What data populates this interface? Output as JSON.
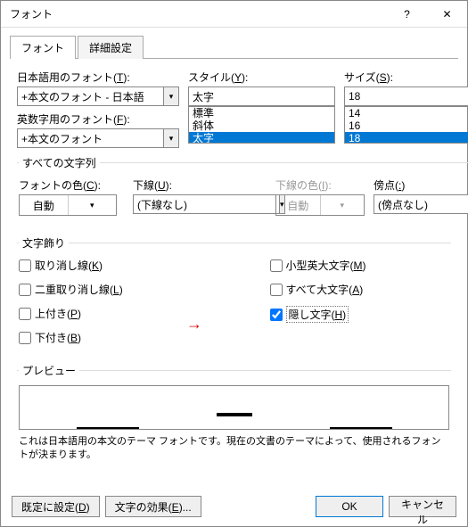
{
  "title": "フォント",
  "tabs": {
    "font": "フォント",
    "advanced": "詳細設定"
  },
  "font": {
    "jpLabelPre": "日本語用のフォント(",
    "jpKey": "T",
    "jpLabelPost": "):",
    "jpValue": "+本文のフォント - 日本語",
    "enLabelPre": "英数字用のフォント(",
    "enKey": "F",
    "enLabelPost": "):",
    "enValue": "+本文のフォント",
    "styleLabelPre": "スタイル(",
    "styleKey": "Y",
    "styleLabelPost": "):",
    "styleValue": "太字",
    "styleOpts": [
      "標準",
      "斜体",
      "太字"
    ],
    "sizeLabelPre": "サイズ(",
    "sizeKey": "S",
    "sizeLabelPost": "):",
    "sizeValue": "18",
    "sizeOpts": [
      "14",
      "16",
      "18"
    ]
  },
  "allchars": {
    "legend": "すべての文字列",
    "colorLabelPre": "フォントの色(",
    "colorKey": "C",
    "colorLabelPost": "):",
    "colorValue": "自動",
    "ulLabelPre": "下線(",
    "ulKey": "U",
    "ulLabelPost": "):",
    "ulValue": "(下線なし)",
    "ulcLabelPre": "下線の色(",
    "ulcKey": "I",
    "ulcLabelPost": "):",
    "ulcValue": "自動",
    "emLabelPre": "傍点(",
    "emKey": ":",
    "emLabelPost": ")",
    "emValue": "(傍点なし)"
  },
  "effects": {
    "legend": "文字飾り",
    "strike": "取り消し線(",
    "strikeKey": "K",
    "post": ")",
    "dstrike": "二重取り消し線(",
    "dstrikeKey": "L",
    "sup": "上付き(",
    "supKey": "P",
    "sub": "下付き(",
    "subKey": "B",
    "small": "小型英大文字(",
    "smallKey": "M",
    "allcap": "すべて大文字(",
    "allcapKey": "A",
    "hidden": "隠し文字(",
    "hiddenKey": "H"
  },
  "preview": {
    "legend": "プレビュー",
    "desc": "これは日本語用の本文のテーマ フォントです。現在の文書のテーマによって、使用されるフォントが決まります。"
  },
  "footer": {
    "default": "既定に設定(",
    "defaultKey": "D",
    "defaultPost": ")",
    "textfx": "文字の効果(",
    "textfxKey": "E",
    "textfxPost": ")...",
    "ok": "OK",
    "cancel": "キャンセル"
  }
}
